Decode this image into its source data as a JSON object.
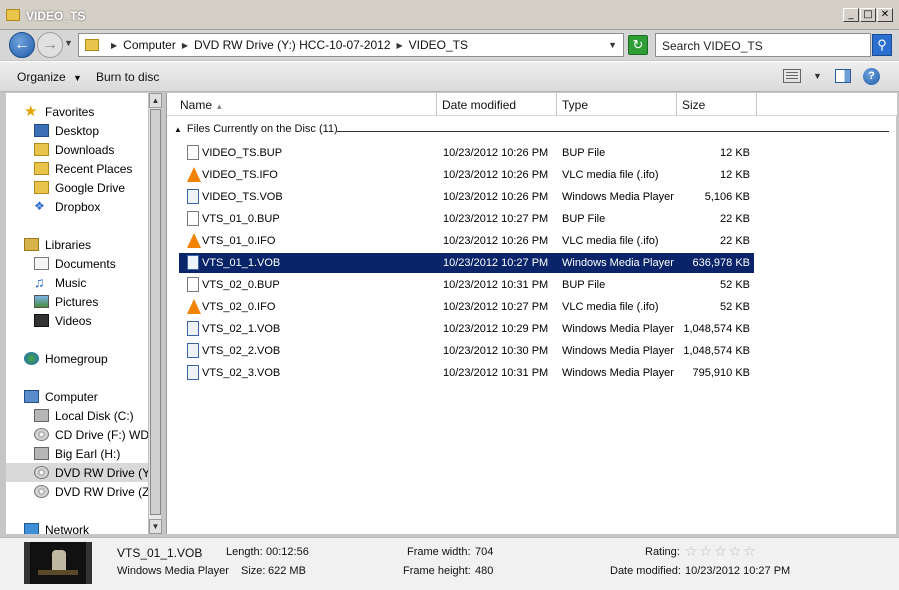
{
  "window": {
    "title": "VIDEO_TS",
    "minimize": "_",
    "maximize": "□",
    "close": "✕"
  },
  "address": {
    "crumbs": [
      "Computer",
      "DVD RW Drive (Y:) HCC-10-07-2012",
      "VIDEO_TS"
    ],
    "search_placeholder": "Search VIDEO_TS"
  },
  "toolbar": {
    "organize": "Organize",
    "burn": "Burn to disc"
  },
  "navpane": {
    "favorites": {
      "label": "Favorites",
      "items": [
        "Desktop",
        "Downloads",
        "Recent Places",
        "Google Drive",
        "Dropbox"
      ]
    },
    "libraries": {
      "label": "Libraries",
      "items": [
        "Documents",
        "Music",
        "Pictures",
        "Videos"
      ]
    },
    "homegroup": "Homegroup",
    "computer": {
      "label": "Computer",
      "items": [
        "Local Disk (C:)",
        "CD Drive (F:) WD SmartWare",
        "Big Earl (H:)",
        "DVD RW Drive (Y:)",
        "DVD RW Drive (Z:)"
      ]
    },
    "network": "Network"
  },
  "columns": {
    "name": "Name",
    "date": "Date modified",
    "type": "Type",
    "size": "Size"
  },
  "group_header": "Files Currently on the Disc (11)",
  "files": [
    {
      "name": "VIDEO_TS.BUP",
      "date": "10/23/2012 10:26 PM",
      "type": "BUP File",
      "size": "12 KB",
      "icon": "bup-file-icon"
    },
    {
      "name": "VIDEO_TS.IFO",
      "date": "10/23/2012 10:26 PM",
      "type": "VLC media file (.ifo)",
      "size": "12 KB",
      "icon": "vlc-cone-icon"
    },
    {
      "name": "VIDEO_TS.VOB",
      "date": "10/23/2012 10:26 PM",
      "type": "Windows Media Player",
      "size": "5,106 KB",
      "icon": "media-file-icon"
    },
    {
      "name": "VTS_01_0.BUP",
      "date": "10/23/2012 10:27 PM",
      "type": "BUP File",
      "size": "22 KB",
      "icon": "bup-file-icon"
    },
    {
      "name": "VTS_01_0.IFO",
      "date": "10/23/2012 10:26 PM",
      "type": "VLC media file (.ifo)",
      "size": "22 KB",
      "icon": "vlc-cone-icon"
    },
    {
      "name": "VTS_01_1.VOB",
      "date": "10/23/2012 10:27 PM",
      "type": "Windows Media Player",
      "size": "636,978 KB",
      "icon": "media-file-icon"
    },
    {
      "name": "VTS_02_0.BUP",
      "date": "10/23/2012 10:31 PM",
      "type": "BUP File",
      "size": "52 KB",
      "icon": "bup-file-icon"
    },
    {
      "name": "VTS_02_0.IFO",
      "date": "10/23/2012 10:27 PM",
      "type": "VLC media file (.ifo)",
      "size": "52 KB",
      "icon": "vlc-cone-icon"
    },
    {
      "name": "VTS_02_1.VOB",
      "date": "10/23/2012 10:29 PM",
      "type": "Windows Media Player",
      "size": "1,048,574 KB",
      "icon": "media-file-icon"
    },
    {
      "name": "VTS_02_2.VOB",
      "date": "10/23/2012 10:30 PM",
      "type": "Windows Media Player",
      "size": "1,048,574 KB",
      "icon": "media-file-icon"
    },
    {
      "name": "VTS_02_3.VOB",
      "date": "10/23/2012 10:31 PM",
      "type": "Windows Media Player",
      "size": "795,910 KB",
      "icon": "media-file-icon"
    }
  ],
  "selected_index": 5,
  "details": {
    "name": "VTS_01_1.VOB",
    "type": "Windows Media Player",
    "length_label": "Length:",
    "length": "00:12:56",
    "size_label": "Size:",
    "size": "622 MB",
    "frame_width_label": "Frame width:",
    "frame_width": "704",
    "frame_height_label": "Frame height:",
    "frame_height": "480",
    "rating_label": "Rating:",
    "rating_stars": "☆☆☆☆☆",
    "date_label": "Date modified:",
    "date": "10/23/2012 10:27 PM"
  },
  "colors": {
    "selection": "#0a246a",
    "accent": "#1f5da8"
  }
}
